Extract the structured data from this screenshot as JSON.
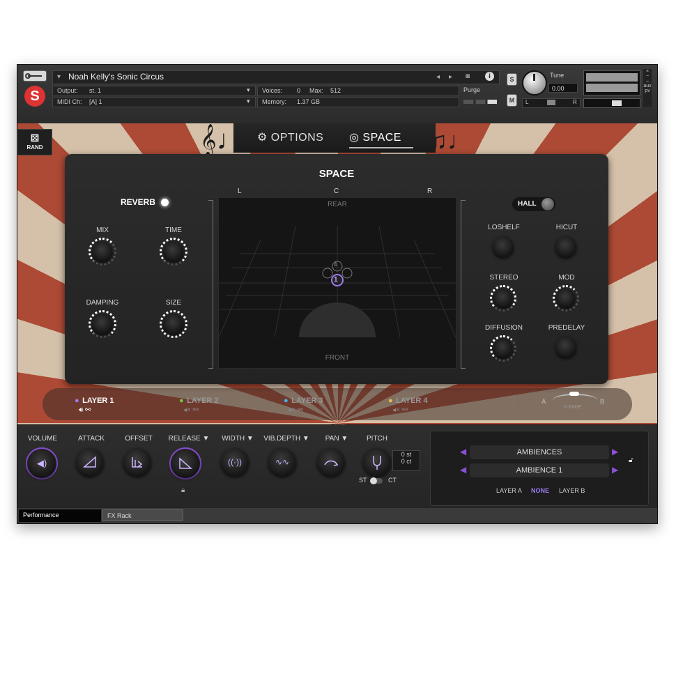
{
  "header": {
    "instrument_name": "Noah Kelly's Sonic Circus",
    "output_label": "Output:",
    "output_value": "st. 1",
    "midi_label": "MIDI Ch:",
    "midi_value": "[A]  1",
    "voices_label": "Voices:",
    "voices_value": "0",
    "max_label": "Max:",
    "max_value": "512",
    "memory_label": "Memory:",
    "memory_value": "1.37 GB",
    "purge_label": "Purge",
    "s_label": "S",
    "m_label": "M",
    "tune_label": "Tune",
    "tune_value": "0.00",
    "pan_l": "L",
    "pan_r": "R",
    "aux_label": "aux",
    "pv_label": "pv"
  },
  "tabs": {
    "options": "OPTIONS",
    "space": "SPACE"
  },
  "rand_label": "RAND",
  "space_panel": {
    "title": "SPACE",
    "reverb_label": "REVERB",
    "left_knobs": [
      {
        "label": "MIX"
      },
      {
        "label": "TIME"
      },
      {
        "label": "DAMPING"
      },
      {
        "label": "SIZE"
      }
    ],
    "axis": {
      "left": "L",
      "center": "C",
      "right": "R",
      "rear": "REAR",
      "front": "FRONT"
    },
    "markers": [
      "4",
      "1"
    ],
    "hall_label": "HALL",
    "right_knobs": [
      {
        "label": "LOSHELF"
      },
      {
        "label": "HICUT"
      },
      {
        "label": "STEREO"
      },
      {
        "label": "MOD"
      },
      {
        "label": "DIFFUSION"
      },
      {
        "label": "PREDELAY"
      }
    ]
  },
  "layers": [
    {
      "label": "LAYER 1",
      "color": "#9b7bf0",
      "active": true
    },
    {
      "label": "LAYER 2",
      "color": "#6cc94a",
      "active": false
    },
    {
      "label": "LAYER 3",
      "color": "#4ab2e8",
      "active": false
    },
    {
      "label": "LAYER 4",
      "color": "#f2b94a",
      "active": false
    }
  ],
  "xfade": {
    "a": "A",
    "b": "B",
    "label": "X-FADE"
  },
  "controls": [
    {
      "label": "VOLUME",
      "icon": "speaker-icon"
    },
    {
      "label": "ATTACK",
      "icon": "ramp-up-icon"
    },
    {
      "label": "OFFSET",
      "icon": "offset-icon"
    },
    {
      "label": "RELEASE ▼",
      "icon": "ramp-down-icon"
    },
    {
      "label": "WIDTH ▼",
      "icon": "width-icon"
    },
    {
      "label": "VIB.DEPTH ▼",
      "icon": "vibrato-icon"
    },
    {
      "label": "PAN  ▼",
      "icon": "pan-icon"
    },
    {
      "label": "PITCH",
      "icon": "tuning-fork-icon"
    }
  ],
  "pitch": {
    "st": "0 st",
    "ct": "0 ct",
    "st_label": "ST",
    "ct_label": "CT"
  },
  "ambience": {
    "category": "AMBIENCES",
    "preset": "AMBIENCE 1",
    "targets": [
      "LAYER A",
      "NONE",
      "LAYER B"
    ],
    "accent": "#8a4fd6"
  },
  "bottom_tabs": [
    "Performance",
    "FX Rack"
  ]
}
